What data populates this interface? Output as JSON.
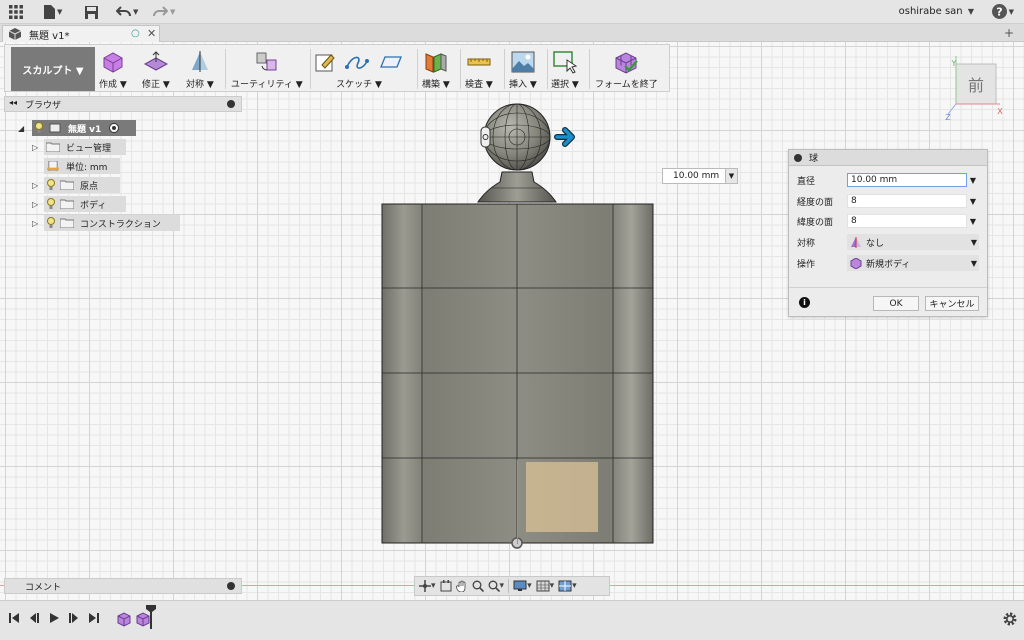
{
  "topbar": {
    "user": "oshirabe san",
    "user_caret": "▼",
    "help_caret": "▼",
    "caret": "▼"
  },
  "tab": {
    "title": "無題 v1*",
    "close": "✕",
    "saved_indicator": "○",
    "add": "+"
  },
  "ribbon": {
    "workspace": "スカルプト ▼",
    "groups": {
      "create": "作成 ▼",
      "modify": "修正 ▼",
      "symmetry": "対称 ▼",
      "utilities": "ユーティリティ ▼",
      "sketch": "スケッチ ▼",
      "construct": "構築 ▼",
      "inspect": "検査 ▼",
      "insert": "挿入 ▼",
      "select": "選択 ▼",
      "finish_form": "フォームを終了"
    }
  },
  "browser": {
    "title": "ブラウザ",
    "root": "無題 v1",
    "items": {
      "views": "ビュー管理",
      "units": "単位: mm",
      "origin": "原点",
      "bodies": "ボディ",
      "construction": "コンストラクション"
    }
  },
  "comments": {
    "title": "コメント"
  },
  "dimension_input": {
    "value": "10.00 mm",
    "caret": "▼"
  },
  "dialog": {
    "title": "球",
    "diameter_label": "直径",
    "diameter_value": "10.00 mm",
    "longitude_label": "経度の面",
    "longitude_value": "8",
    "latitude_label": "緯度の面",
    "latitude_value": "8",
    "symmetry_label": "対称",
    "symmetry_value": "なし",
    "operation_label": "操作",
    "operation_value": "新規ボディ",
    "ok": "OK",
    "cancel": "キャンセル",
    "info": "i",
    "caret": "▼"
  },
  "viewcube": {
    "face": "前",
    "axis_x": "X",
    "axis_y": "Y",
    "axis_z": "Z"
  },
  "colors": {
    "workspace_bg": "#7a7a7a",
    "accent_arrow": "#1a8fc9",
    "dialog_focus": "#6ea2e6",
    "body_metal": "#8f8f85"
  }
}
